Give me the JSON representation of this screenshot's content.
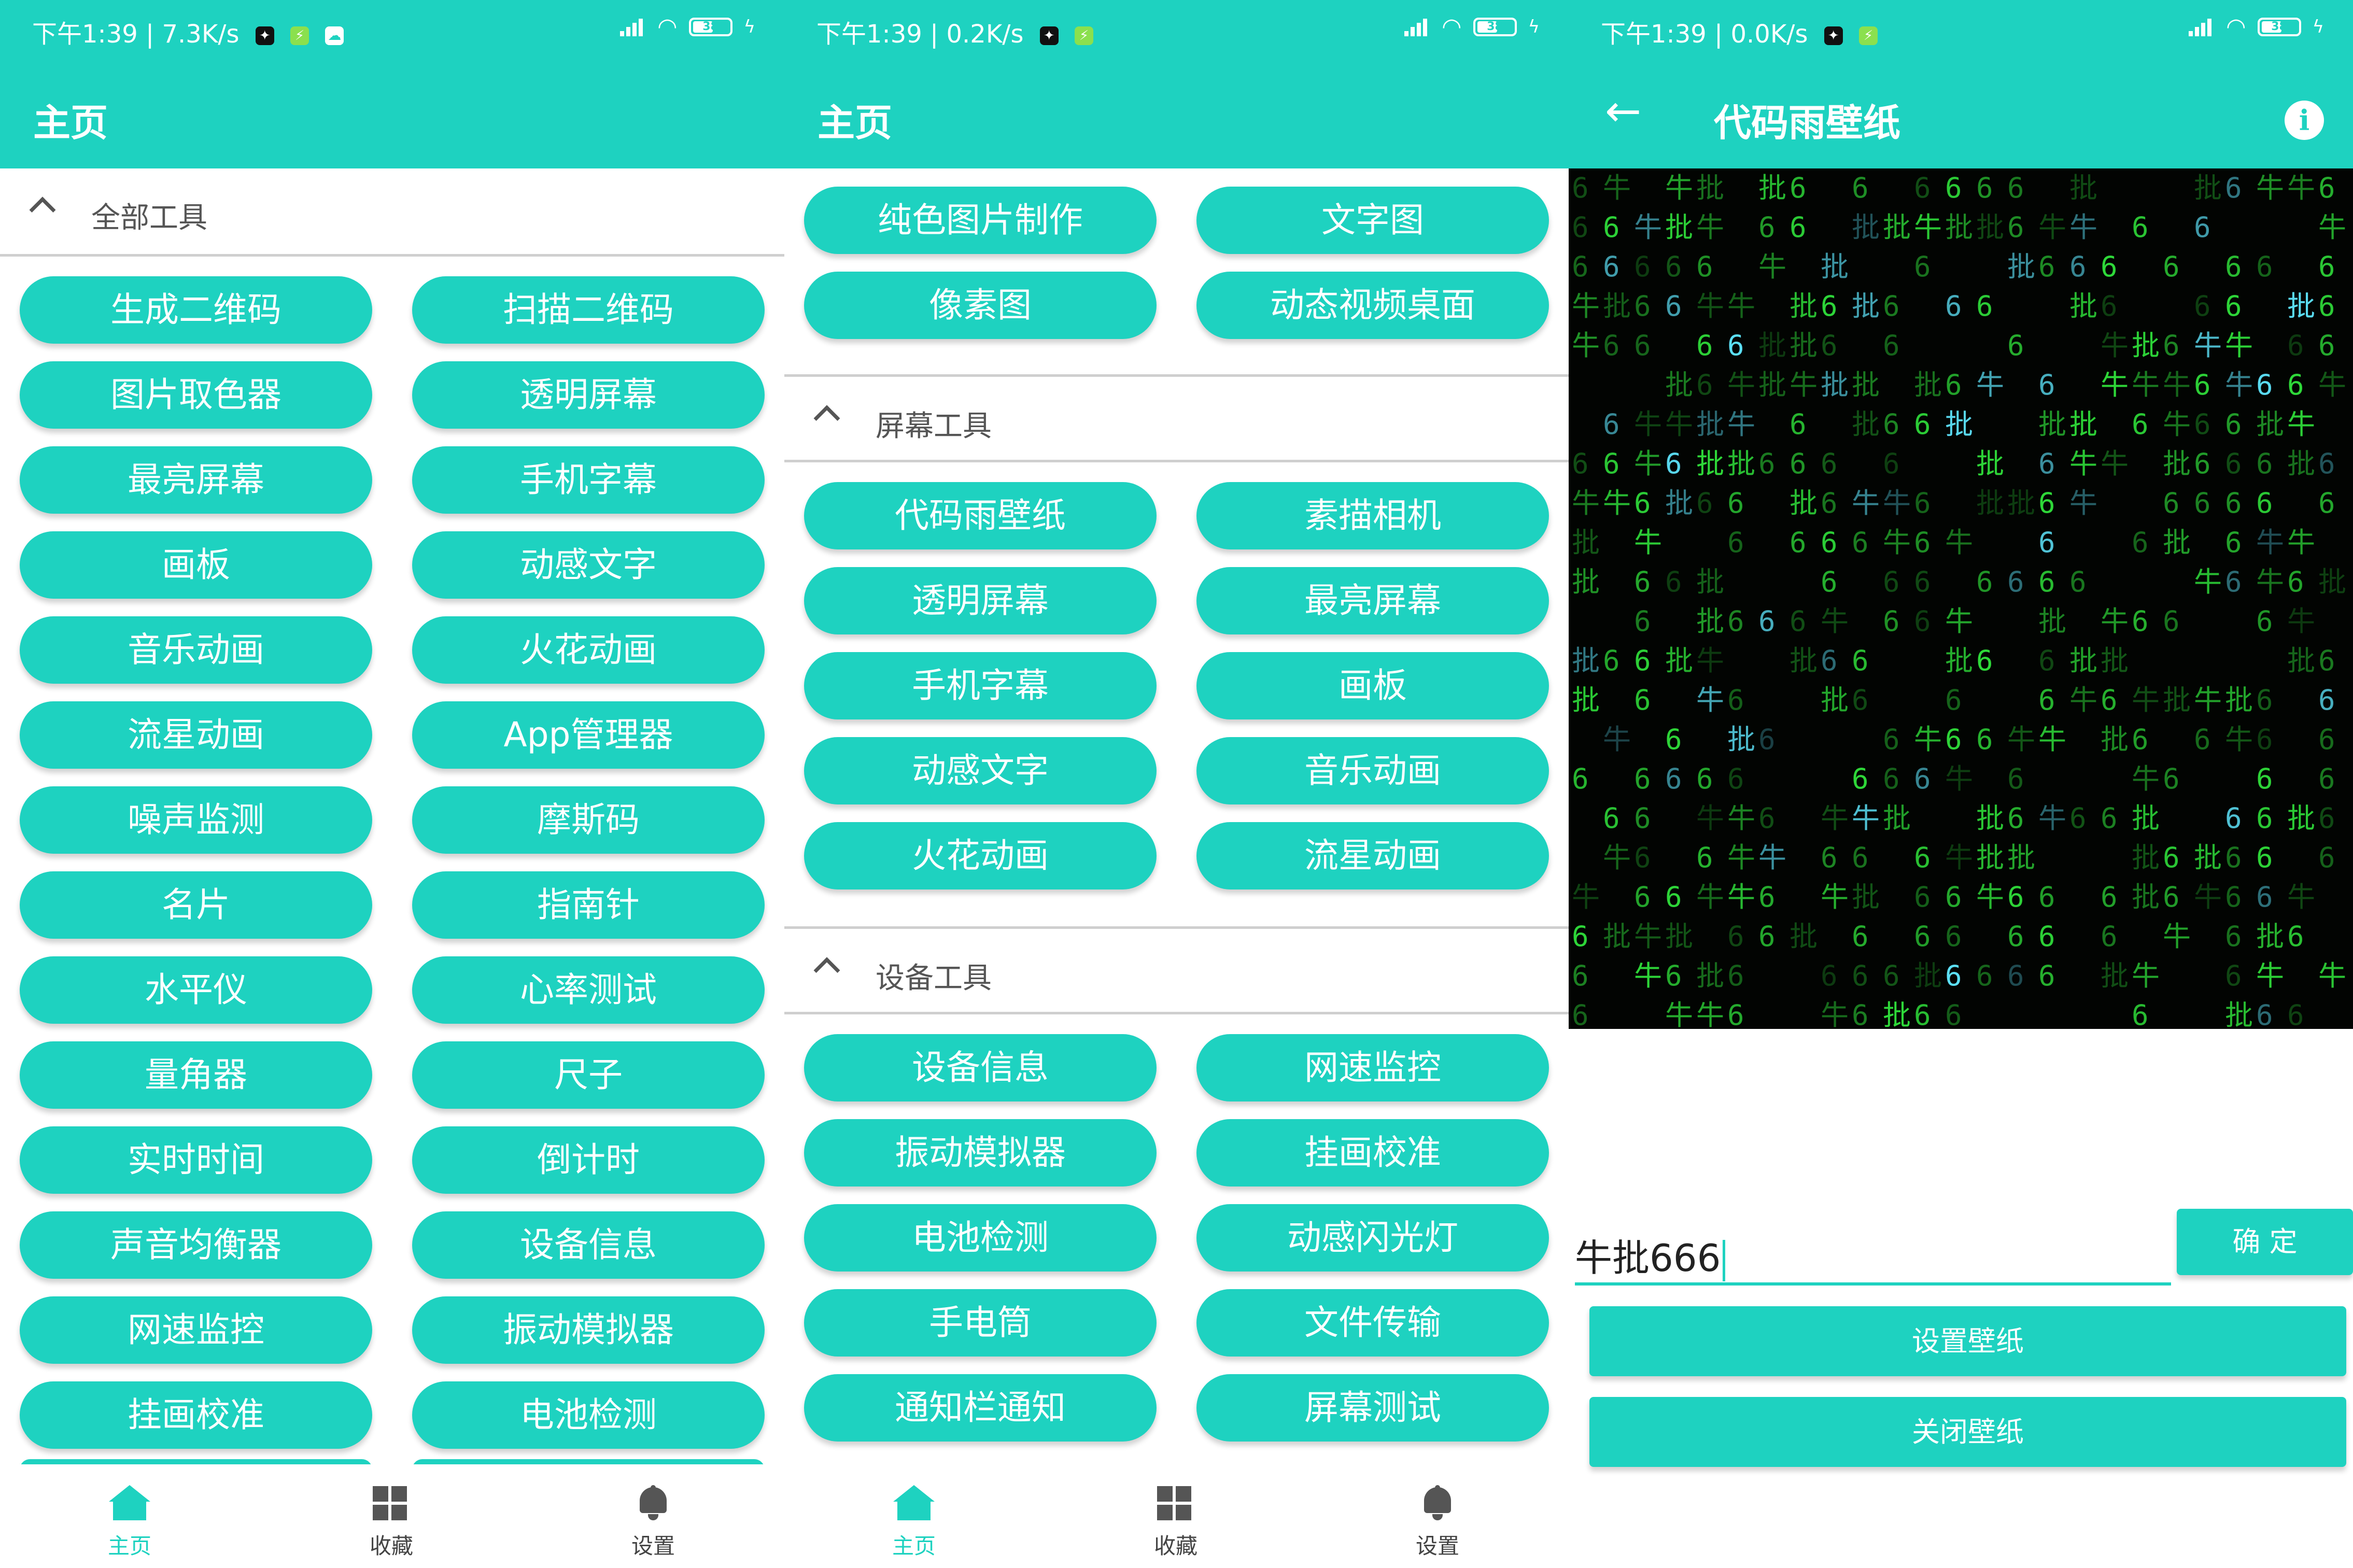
{
  "colors": {
    "accent": "#1ed2c0",
    "matrix_bg": "#020402",
    "matrix_green": "#2fdc3a",
    "matrix_cyan": "#5fe8ff"
  },
  "panel1": {
    "status": {
      "text": "下午1:39 | 7.3K/s"
    },
    "title": "主页",
    "section": "全部工具",
    "buttons": [
      [
        "生成二维码",
        "扫描二维码"
      ],
      [
        "图片取色器",
        "透明屏幕"
      ],
      [
        "最亮屏幕",
        "手机字幕"
      ],
      [
        "画板",
        "动感文字"
      ],
      [
        "音乐动画",
        "火花动画"
      ],
      [
        "流星动画",
        "App管理器"
      ],
      [
        "噪声监测",
        "摩斯码"
      ],
      [
        "名片",
        "指南针"
      ],
      [
        "水平仪",
        "心率测试"
      ],
      [
        "量角器",
        "尺子"
      ],
      [
        "实时时间",
        "倒计时"
      ],
      [
        "声音均衡器",
        "设备信息"
      ],
      [
        "网速监控",
        "振动模拟器"
      ],
      [
        "挂画校准",
        "电池检测"
      ]
    ]
  },
  "panel2": {
    "status": {
      "text": "下午1:39 | 0.2K/s"
    },
    "title": "主页",
    "top_buttons": [
      [
        "纯色图片制作",
        "文字图"
      ],
      [
        "像素图",
        "动态视频桌面"
      ]
    ],
    "section_screen": "屏幕工具",
    "screen_buttons": [
      [
        "代码雨壁纸",
        "素描相机"
      ],
      [
        "透明屏幕",
        "最亮屏幕"
      ],
      [
        "手机字幕",
        "画板"
      ],
      [
        "动感文字",
        "音乐动画"
      ],
      [
        "火花动画",
        "流星动画"
      ]
    ],
    "section_device": "设备工具",
    "device_buttons": [
      [
        "设备信息",
        "网速监控"
      ],
      [
        "振动模拟器",
        "挂画校准"
      ],
      [
        "电池检测",
        "动感闪光灯"
      ],
      [
        "手电筒",
        "文件传输"
      ],
      [
        "通知栏通知",
        "屏幕测试"
      ]
    ]
  },
  "panel3": {
    "status": {
      "text": "下午1:39 | 0.0K/s"
    },
    "title": "代码雨壁纸",
    "input_value": "牛批666",
    "confirm_label": "确 定",
    "set_label": "设置壁纸",
    "close_label": "关闭壁纸"
  },
  "status_common": {
    "battery": "38"
  },
  "nav": {
    "home": "主页",
    "favorites": "收藏",
    "settings": "设置"
  }
}
